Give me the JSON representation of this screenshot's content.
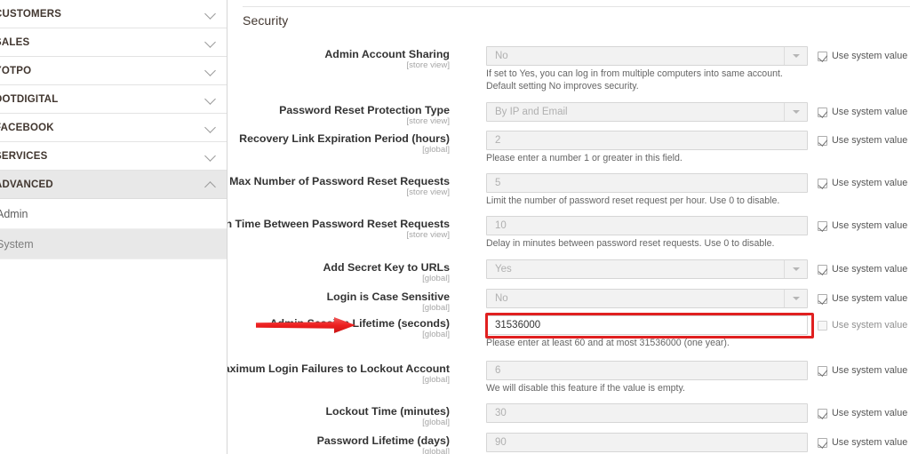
{
  "sidebar": {
    "sections": [
      {
        "label": "CUSTOMERS",
        "icon": "chevron-down-icon",
        "expanded": false
      },
      {
        "label": "SALES",
        "icon": "chevron-down-icon",
        "expanded": false
      },
      {
        "label": "YOTPO",
        "icon": "chevron-down-icon",
        "expanded": false
      },
      {
        "label": "DOTDIGITAL",
        "icon": "chevron-down-icon",
        "expanded": false
      },
      {
        "label": "FACEBOOK",
        "icon": "chevron-down-icon",
        "expanded": false
      },
      {
        "label": "SERVICES",
        "icon": "chevron-down-icon",
        "expanded": false
      },
      {
        "label": "ADVANCED",
        "icon": "chevron-up-icon",
        "expanded": true
      }
    ],
    "subitems": [
      {
        "label": "Admin",
        "selected": false
      },
      {
        "label": "System",
        "selected": true
      }
    ]
  },
  "main": {
    "section_title": "Security",
    "system_value_label": "Use system value",
    "fields": [
      {
        "label": "Admin Account Sharing",
        "scope": "[store view]",
        "control": "select",
        "value": "No",
        "hint": "If set to Yes, you can log in from multiple computers into same account. Default setting No improves security.",
        "use_system_value": true
      },
      {
        "label": "Password Reset Protection Type",
        "scope": "[store view]",
        "control": "select",
        "value": "By IP and Email",
        "hint": "",
        "use_system_value": true
      },
      {
        "label": "Recovery Link Expiration Period (hours)",
        "scope": "[global]",
        "control": "text",
        "value": "2",
        "hint": "Please enter a number 1 or greater in this field.",
        "use_system_value": true
      },
      {
        "label": "Max Number of Password Reset Requests",
        "scope": "[store view]",
        "control": "text",
        "value": "5",
        "hint": "Limit the number of password reset request per hour. Use 0 to disable.",
        "use_system_value": true
      },
      {
        "label": "Min Time Between Password Reset Requests",
        "scope": "[store view]",
        "control": "text",
        "value": "10",
        "hint": "Delay in minutes between password reset requests. Use 0 to disable.",
        "use_system_value": true
      },
      {
        "label": "Add Secret Key to URLs",
        "scope": "[global]",
        "control": "select",
        "value": "Yes",
        "hint": "",
        "use_system_value": true
      },
      {
        "label": "Login is Case Sensitive",
        "scope": "[global]",
        "control": "select",
        "value": "No",
        "hint": "",
        "use_system_value": true
      },
      {
        "label": "Admin Session Lifetime (seconds)",
        "scope": "[global]",
        "control": "text",
        "value": "31536000",
        "hint": "Please enter at least 60 and at most 31536000 (one year).",
        "use_system_value": false,
        "editable": true,
        "highlighted": true
      },
      {
        "label": "Maximum Login Failures to Lockout Account",
        "scope": "[global]",
        "control": "text",
        "value": "6",
        "hint": "We will disable this feature if the value is empty.",
        "use_system_value": true
      },
      {
        "label": "Lockout Time (minutes)",
        "scope": "[global]",
        "control": "text",
        "value": "30",
        "hint": "",
        "use_system_value": true
      },
      {
        "label": "Password Lifetime (days)",
        "scope": "[global]",
        "control": "text",
        "value": "90",
        "hint": "",
        "use_system_value": true
      }
    ]
  },
  "annotations": {
    "arrow_color": "#ec2b2b",
    "highlight_color": "#e02020",
    "arrow_target": "Admin Session Lifetime (seconds)"
  }
}
